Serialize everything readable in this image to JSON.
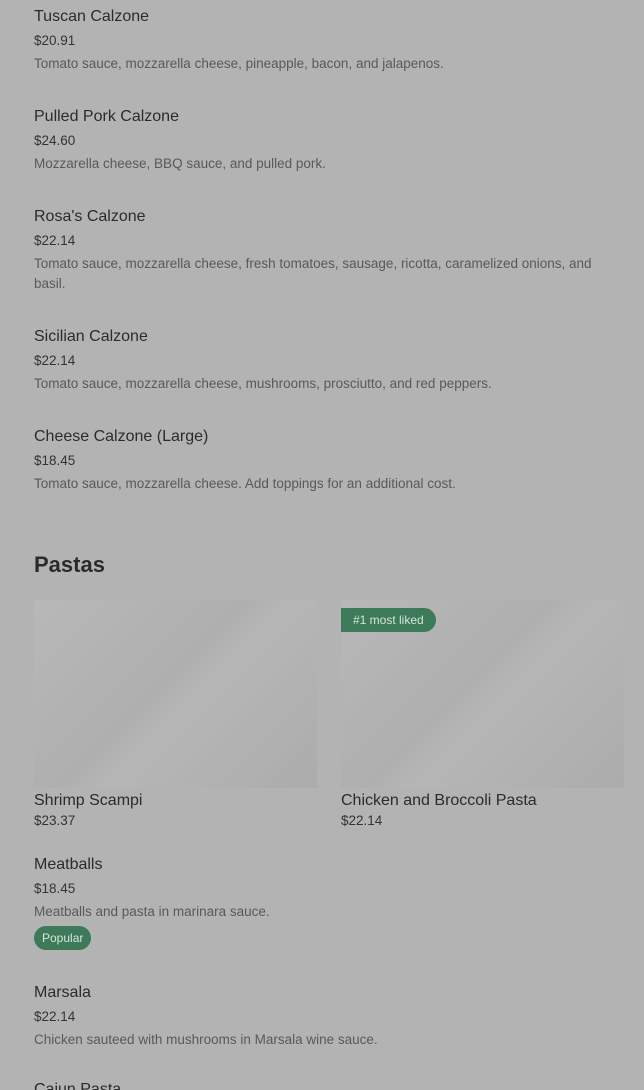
{
  "calzones": [
    {
      "name": "Tuscan Calzone",
      "price": "$20.91",
      "desc": "Tomato sauce, mozzarella cheese, pineapple, bacon, and jalapenos."
    },
    {
      "name": "Pulled Pork Calzone",
      "price": "$24.60",
      "desc": "Mozzarella cheese, BBQ sauce, and pulled pork."
    },
    {
      "name": "Rosa's Calzone",
      "price": "$22.14",
      "desc": "Tomato sauce, mozzarella cheese, fresh tomatoes, sausage, ricotta, caramelized onions, and basil."
    },
    {
      "name": "Sicilian Calzone",
      "price": "$22.14",
      "desc": "Tomato sauce, mozzarella cheese, mushrooms, prosciutto, and red peppers."
    },
    {
      "name": "Cheese Calzone (Large)",
      "price": "$18.45",
      "desc": "Tomato sauce, mozzarella cheese. Add toppings for an additional cost."
    }
  ],
  "pastas": {
    "title": "Pastas",
    "featured": [
      {
        "name": "Shrimp Scampi",
        "price": "$23.37",
        "badge": ""
      },
      {
        "name": "Chicken and Broccoli Pasta",
        "price": "$22.14",
        "badge": "#1 most liked"
      }
    ],
    "items": [
      {
        "name": "Meatballs",
        "price": "$18.45",
        "desc": "Meatballs and pasta in marinara sauce.",
        "badge": "Popular"
      },
      {
        "name": "Marsala",
        "price": "$22.14",
        "desc": "Chicken sauteed with mushrooms in Marsala wine sauce."
      }
    ],
    "cut_off_item": "Cajun Pasta"
  },
  "colors": {
    "background": "#b3b3b3",
    "badge_green": "#3c7a5a"
  }
}
